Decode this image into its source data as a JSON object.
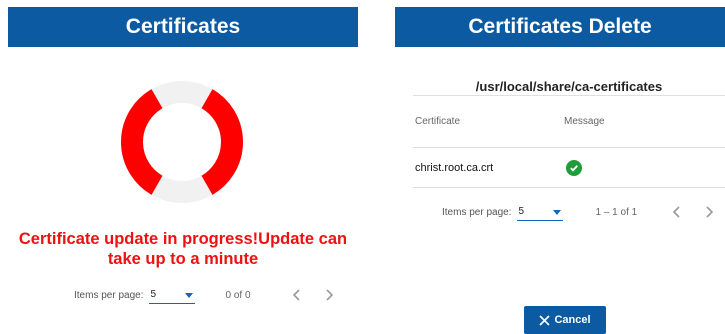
{
  "left_panel": {
    "title": "Certificates",
    "progress_message": "Certificate update in progress!Update can take up to a minute",
    "progress_fraction": 0.55,
    "paginator": {
      "items_per_page_label": "Items per page:",
      "items_per_page_value": "5",
      "range": "0 of 0"
    }
  },
  "right_panel": {
    "title": "Certificates Delete",
    "path": "/usr/local/share/ca-certificates",
    "table": {
      "columns": [
        "Certificate",
        "Message"
      ],
      "rows": [
        {
          "certificate": "christ.root.ca.crt",
          "message_icon": "check-circle-icon"
        }
      ]
    },
    "paginator": {
      "items_per_page_label": "Items per page:",
      "items_per_page_value": "5",
      "range": "1 – 1 of 1"
    },
    "cancel_label": "Cancel"
  },
  "colors": {
    "header": "#0b5aa2",
    "progress_red": "#ff0000",
    "track_gray": "#f1f1f1",
    "error_text": "#ee1111",
    "success_green": "#1f9d3a"
  }
}
